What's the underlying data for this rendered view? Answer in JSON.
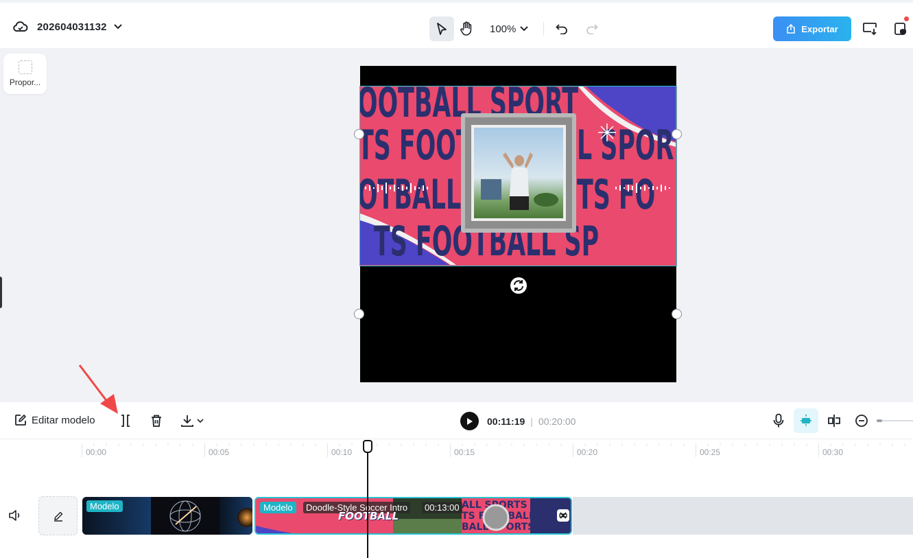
{
  "header": {
    "project_name": "202604031132",
    "zoom_level": "100%",
    "export_label": "Exportar"
  },
  "canvas": {
    "ratio_label": "Propor...",
    "preview_text": [
      "OOTBALL SPORT",
      "TS FOOT",
      "L SPOR",
      "OTBALL",
      "TS FO",
      "TS FOOTBALL SP"
    ]
  },
  "timeline_toolbar": {
    "edit_model_label": "Editar modelo",
    "current_time": "00:11:19",
    "separator": "|",
    "total_time": "00:20:00"
  },
  "ruler": {
    "labels": [
      "00:00",
      "00:05",
      "00:10",
      "00:15",
      "00:20",
      "00:25",
      "00:30"
    ]
  },
  "tracks": {
    "clip1": {
      "tag": "Modelo"
    },
    "clip2": {
      "tag": "Modelo",
      "title": "Doodle-Style Soccer Intro",
      "duration": "00:13:00",
      "thumb_text": "FOOTBALL"
    }
  },
  "colors": {
    "accent": "#27c3d3",
    "export_start": "#3b8ff3",
    "export_end": "#2ab3ee",
    "preview_pink": "#ea4a6d",
    "preview_navy": "#2b2f6e",
    "notification_red": "#f04848"
  }
}
